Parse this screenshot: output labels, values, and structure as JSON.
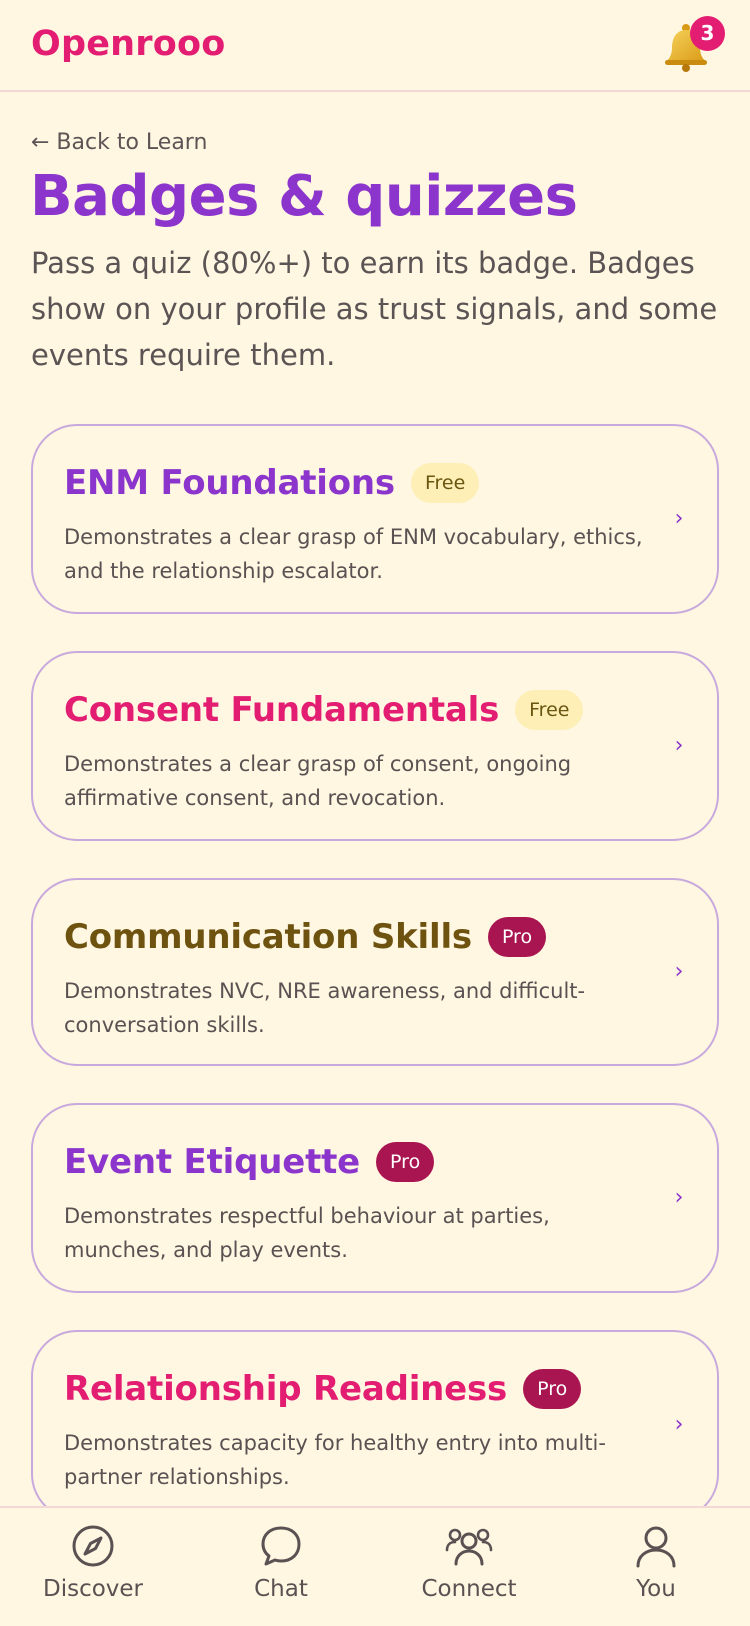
{
  "header": {
    "brand": "Openrooo",
    "notifications": {
      "icon": "bell-icon",
      "count": "3"
    }
  },
  "page": {
    "back_link": "← Back to Learn",
    "title": "Badges & quizzes",
    "intro": "Pass a quiz (80%+) to earn its badge. Badges show on your profile as trust signals, and some events require them."
  },
  "badges": [
    {
      "title": "ENM Foundations",
      "tier": "Free",
      "description": "Demonstrates a clear grasp of ENM vocabulary, ethics, and the relationship escalator.",
      "title_color": "#8b35cc"
    },
    {
      "title": "Consent Fundamentals",
      "tier": "Free",
      "description": "Demonstrates a clear grasp of consent, ongoing affirmative consent, and revocation.",
      "title_color": "#e21d72"
    },
    {
      "title": "Communication Skills",
      "tier": "Pro",
      "description": "Demonstrates NVC, NRE awareness, and difficult-conversation skills.",
      "title_color": "#6e5210"
    },
    {
      "title": "Event Etiquette",
      "tier": "Pro",
      "description": "Demonstrates respectful behaviour at parties, munches, and play events.",
      "title_color": "#8b35cc"
    },
    {
      "title": "Relationship Readiness",
      "tier": "Pro",
      "description": "Demonstrates capacity for healthy entry into multi-partner relationships.",
      "title_color": "#e21d72"
    }
  ],
  "chevron": "›",
  "bottom_nav": [
    {
      "label": "Discover",
      "icon": "compass-icon"
    },
    {
      "label": "Chat",
      "icon": "chat-bubble-icon"
    },
    {
      "label": "Connect",
      "icon": "people-icon"
    },
    {
      "label": "You",
      "icon": "person-icon"
    }
  ],
  "colors": {
    "background": "#fff7e1",
    "brand_pink": "#e21d72",
    "purple": "#8b35cc",
    "card_border": "#c8a9de",
    "free_badge_bg": "#fdefb6",
    "pro_badge_bg": "#a81550"
  }
}
